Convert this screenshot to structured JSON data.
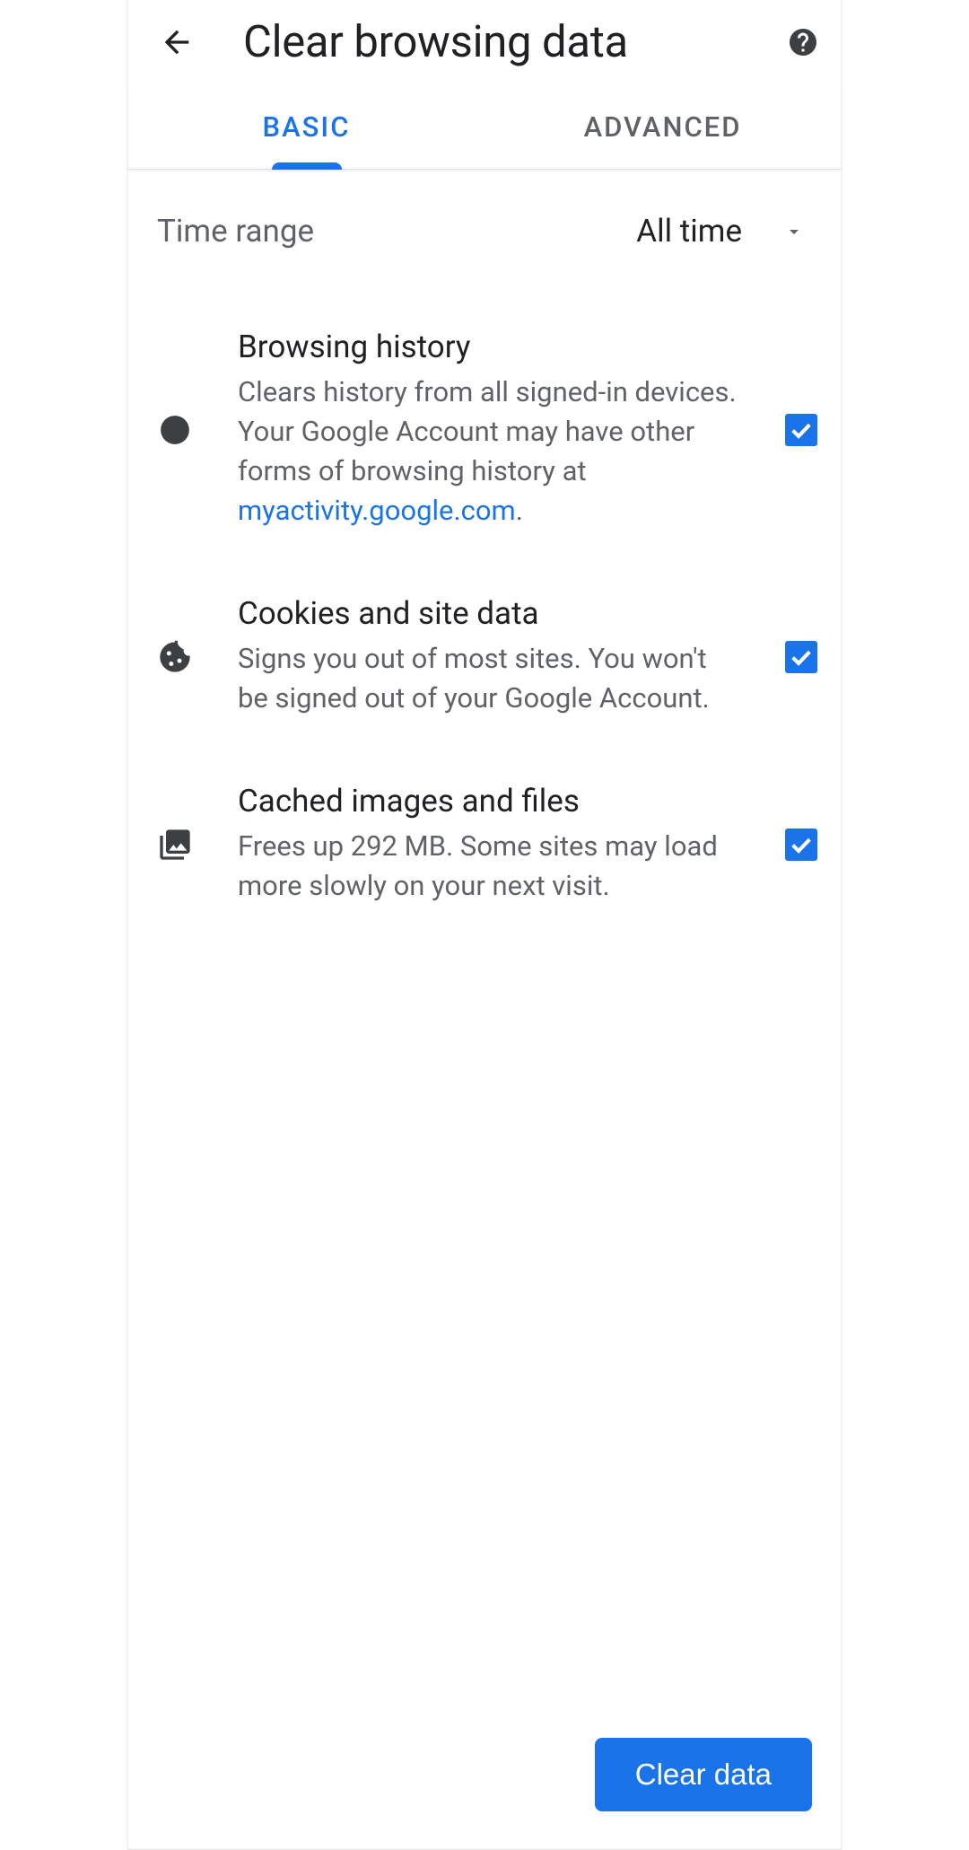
{
  "header": {
    "title": "Clear browsing data"
  },
  "tabs": {
    "basic": "BASIC",
    "advanced": "ADVANCED"
  },
  "time_range": {
    "label": "Time range",
    "value": "All time"
  },
  "options": [
    {
      "title": "Browsing history",
      "desc_prefix": "Clears history from all signed-in devices. Your Google Account may have other forms of browsing history at ",
      "desc_link": "myactivity.google.com",
      "desc_suffix": ".",
      "checked": true
    },
    {
      "title": "Cookies and site data",
      "desc": "Signs you out of most sites. You won't be signed out of your Google Account.",
      "checked": true
    },
    {
      "title": "Cached images and files",
      "desc": "Frees up 292 MB. Some sites may load more slowly on your next visit.",
      "checked": true
    }
  ],
  "clear_button": "Clear data"
}
